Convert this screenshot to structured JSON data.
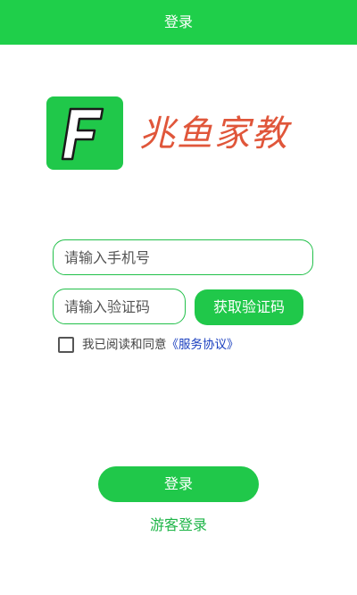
{
  "header": {
    "title": "登录"
  },
  "brand": {
    "logo_icon": "letter-f-icon",
    "name": "兆鱼家教",
    "color_accent": "#20c84a",
    "color_brand_text": "#e0563a"
  },
  "form": {
    "phone": {
      "placeholder": "请输入手机号",
      "value": ""
    },
    "code": {
      "placeholder": "请输入验证码",
      "value": ""
    },
    "get_code_label": "获取验证码",
    "agreement": {
      "checked": false,
      "text": "我已阅读和同意",
      "link_text": "《服务协议》"
    },
    "login_label": "登录",
    "guest_label": "游客登录"
  }
}
